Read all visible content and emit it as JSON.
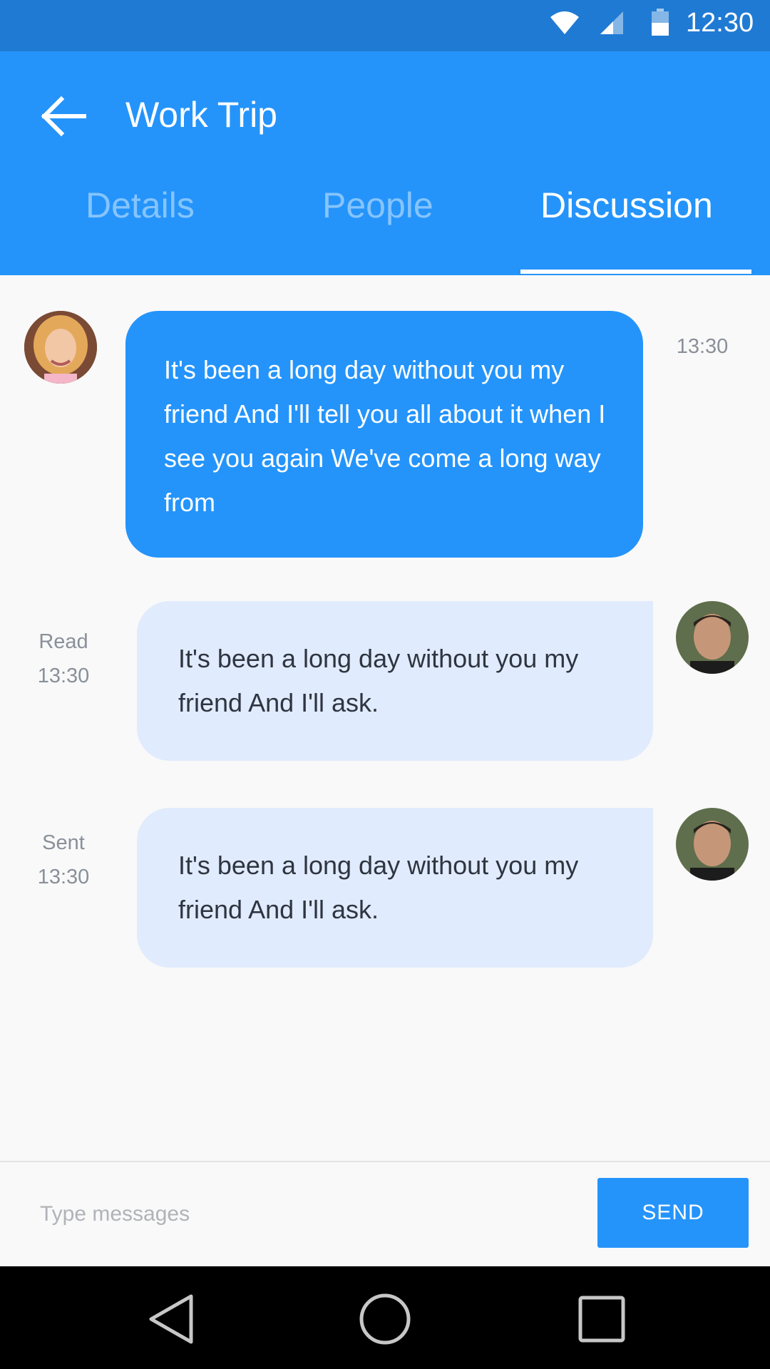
{
  "status_bar": {
    "time": "12:30",
    "icons": [
      "wifi-icon",
      "signal-icon",
      "battery-icon"
    ]
  },
  "app_bar": {
    "title": "Work Trip",
    "back_icon": "arrow-back-icon",
    "tabs": [
      {
        "label": "Details",
        "active": false
      },
      {
        "label": "People",
        "active": false
      },
      {
        "label": "Discussion",
        "active": true
      }
    ]
  },
  "messages": [
    {
      "direction": "incoming",
      "text": "It's been a long day without you my friend And I'll tell you all about it when I see you again We've come a long way from",
      "time": "13:30",
      "status": ""
    },
    {
      "direction": "outgoing",
      "text": "It's been a long day without you my friend And I'll ask.",
      "time": "13:30",
      "status": "Read"
    },
    {
      "direction": "outgoing",
      "text": "It's been a long day without you my friend And I'll ask.",
      "time": "13:30",
      "status": "Sent"
    }
  ],
  "composer": {
    "placeholder": "Type messages",
    "value": "",
    "send_label": "SEND"
  },
  "nav_bar": {
    "icons": [
      "nav-back-icon",
      "nav-home-icon",
      "nav-recents-icon"
    ]
  },
  "colors": {
    "primary": "#2494fb",
    "status_bar": "#1f7ad3",
    "outgoing_bubble": "#e0ebfd"
  }
}
